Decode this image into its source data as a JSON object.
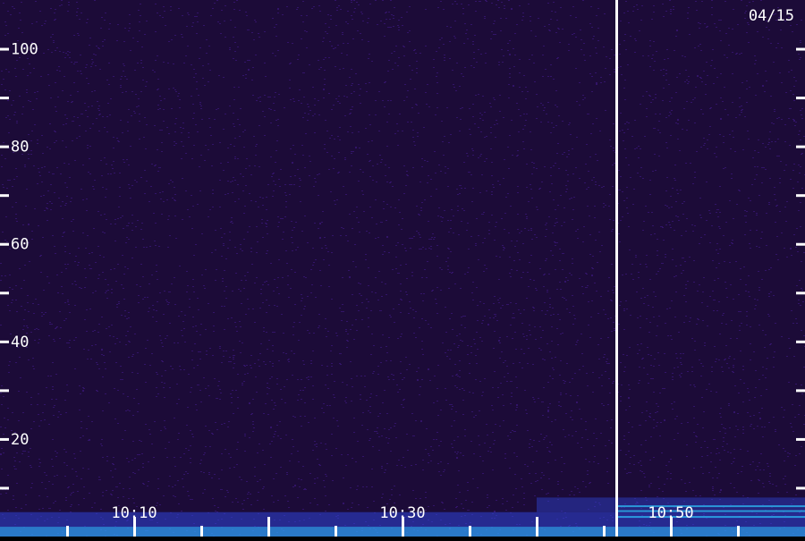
{
  "chart_data": {
    "type": "heatmap",
    "date_label": "04/15",
    "y_axis": {
      "min": 0,
      "max": 110,
      "tick_step": 10,
      "labels": [
        100,
        80,
        60,
        40,
        20
      ]
    },
    "x_axis": {
      "start": "10:00",
      "end": "11:00",
      "labels": [
        "10:10",
        "10:30",
        "10:50"
      ],
      "label_minutes": [
        10,
        30,
        50
      ],
      "major_tick_minutes": [
        5,
        10,
        15,
        20,
        25,
        30,
        35,
        40,
        45,
        50,
        55
      ]
    },
    "marker": {
      "time": "10:46"
    },
    "colors": {
      "background": "#1c0b38",
      "noise": "#3a1878",
      "low_band": "#2f45d8",
      "hot_band": "#2ec8ff",
      "marker": "#ffffff"
    }
  }
}
